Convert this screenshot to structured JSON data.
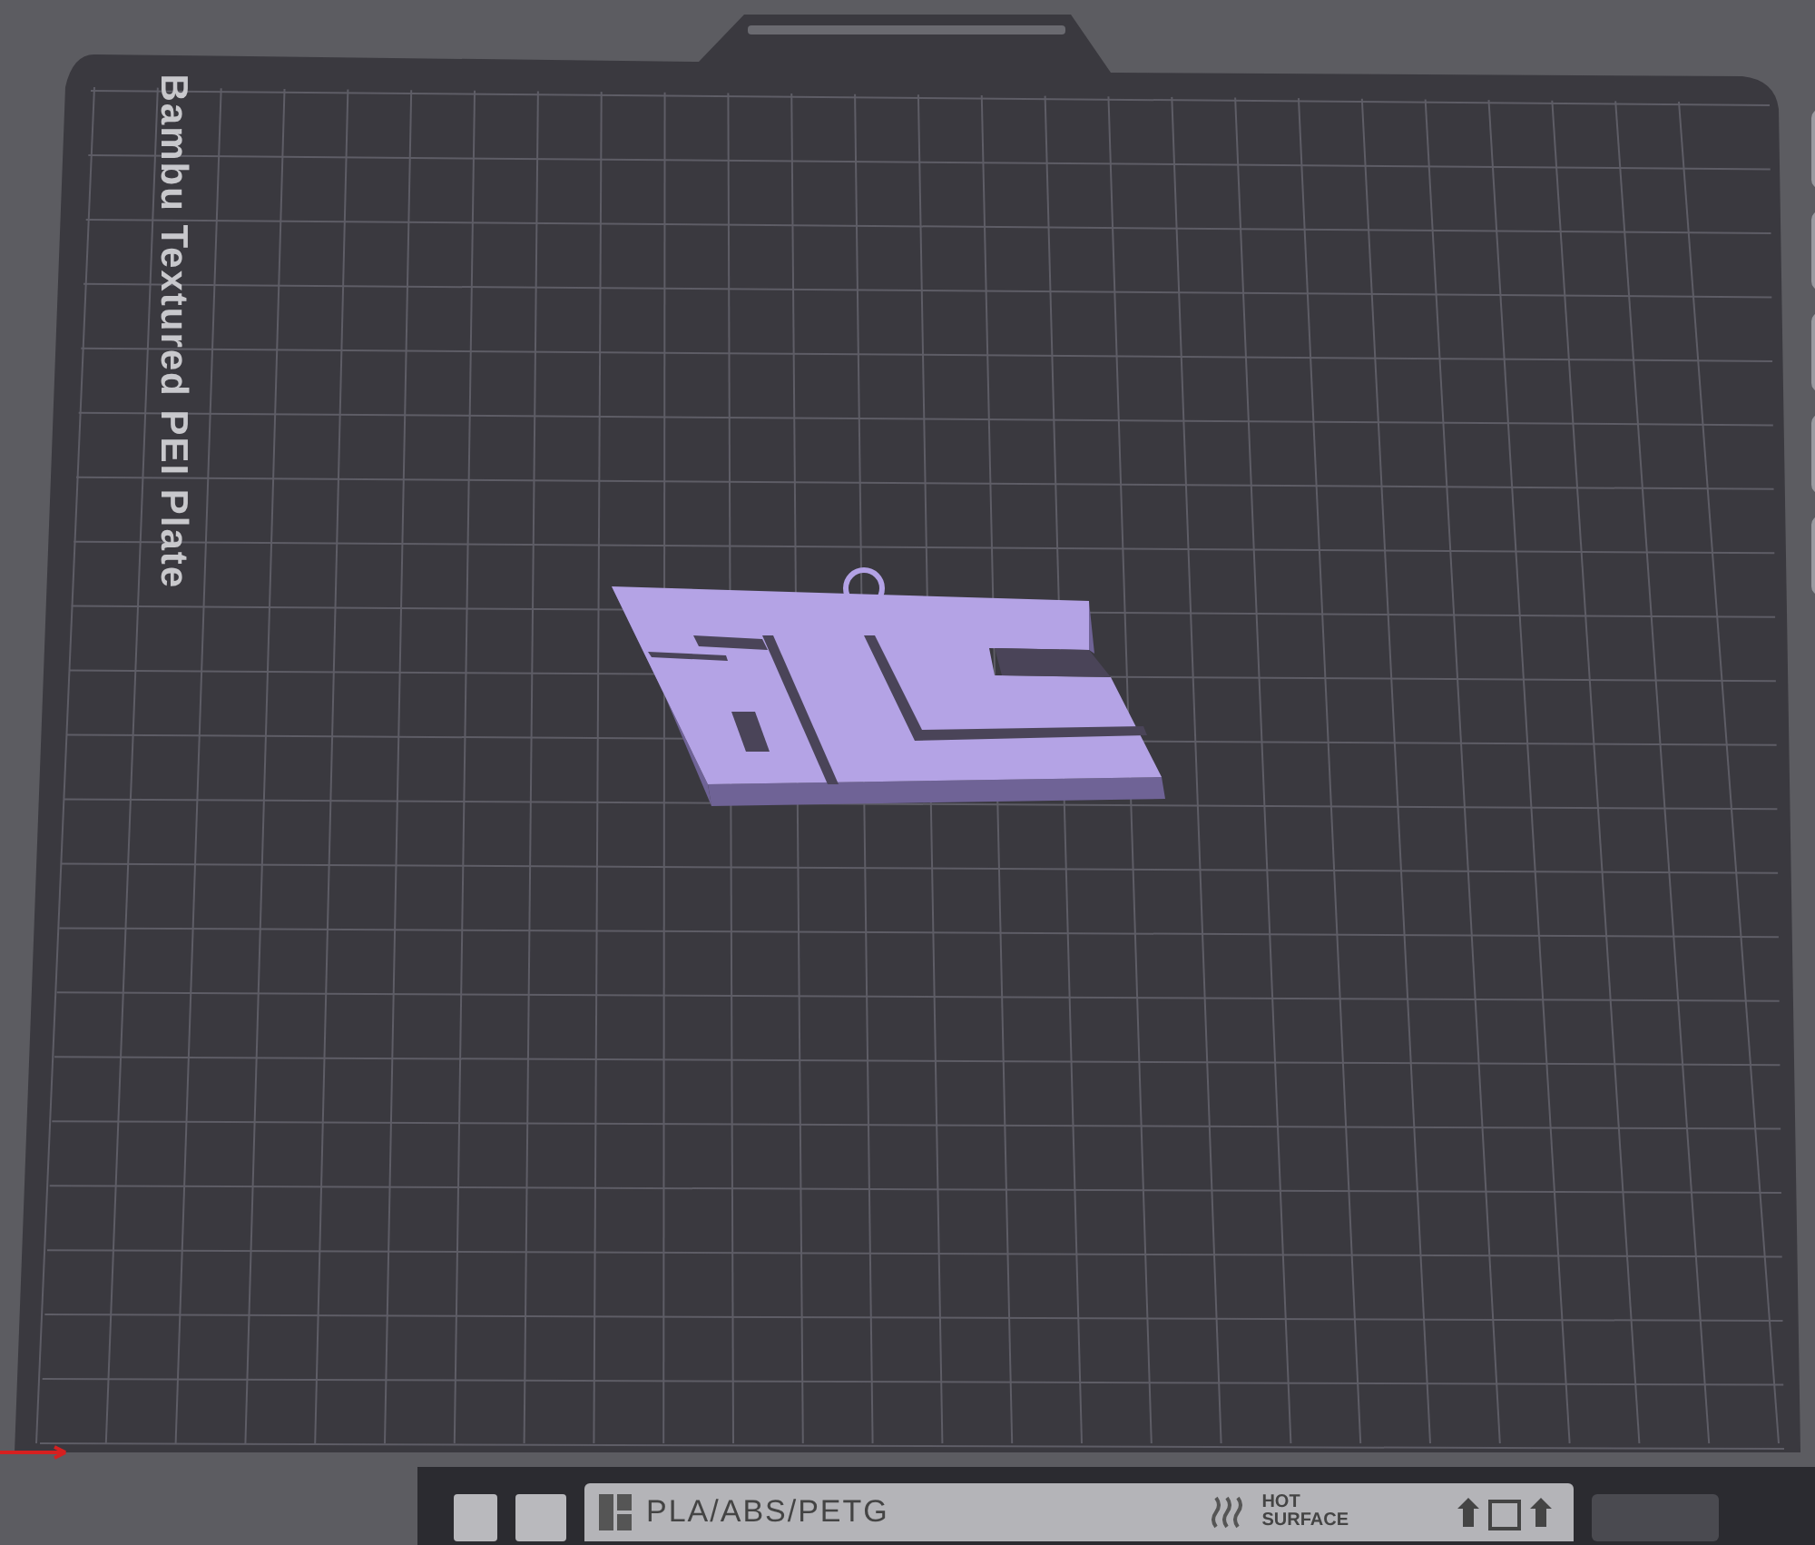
{
  "plate": {
    "name": "Bambu Textured PEI Plate"
  },
  "label_strip": {
    "material": "PLA/ABS/PETG",
    "warning": [
      "HOT",
      "SURFACE"
    ]
  }
}
